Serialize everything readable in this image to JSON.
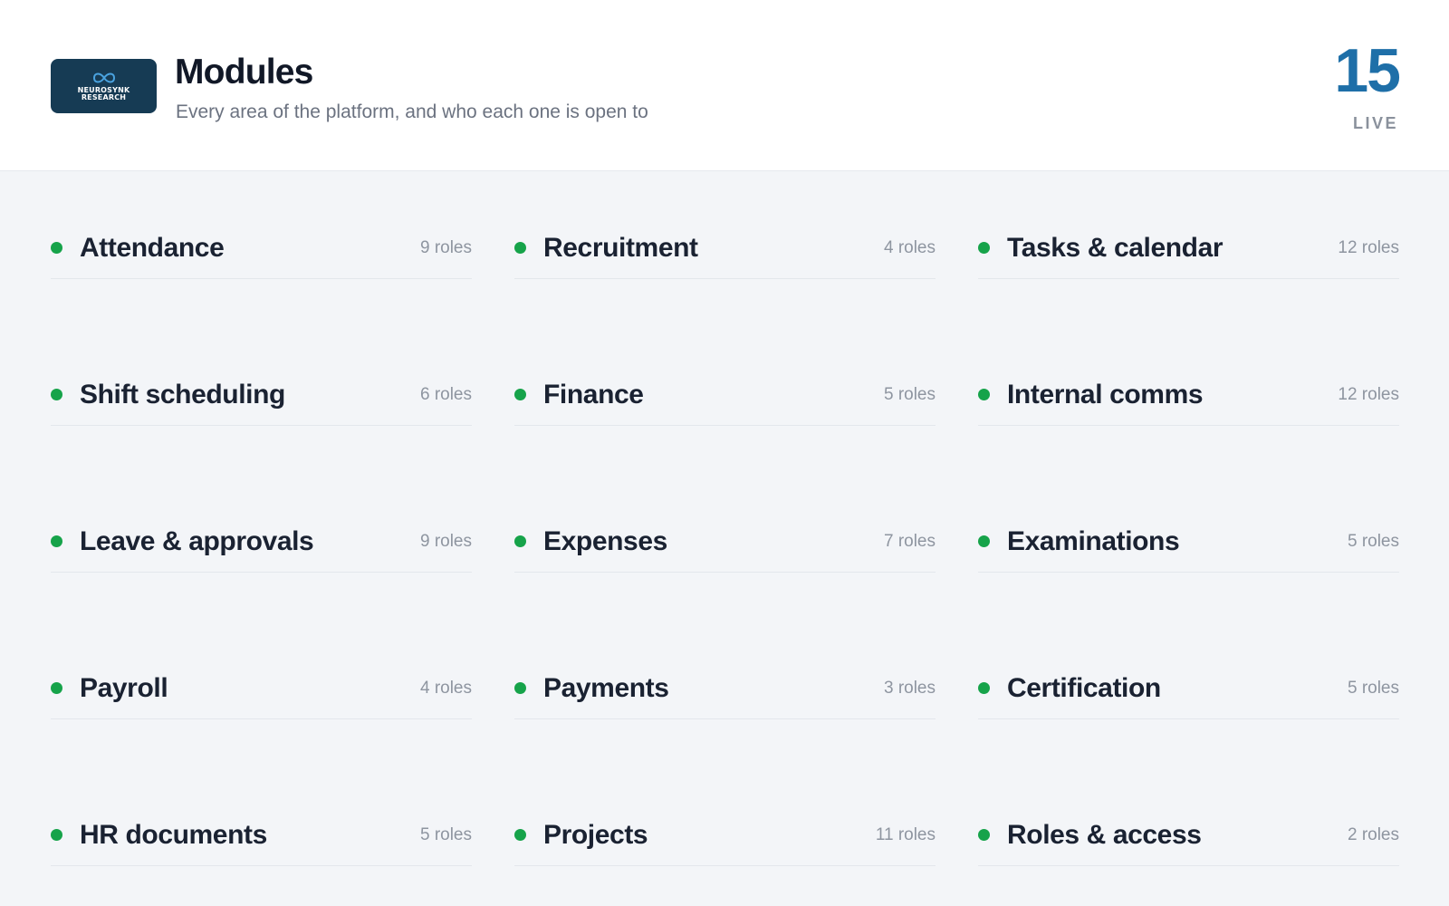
{
  "header": {
    "logo": {
      "line1": "NEUROSYNK",
      "line2": "RESEARCH",
      "icon": "infinity-icon"
    },
    "title": "Modules",
    "subtitle": "Every area of the platform, and who each one is open to",
    "count": "15",
    "count_label": "LIVE"
  },
  "colors": {
    "accent": "#1e6fa8",
    "status_dot": "#16a34a",
    "logo_bg": "#163b54"
  },
  "modules": [
    {
      "name": "Attendance",
      "roles": "9 roles"
    },
    {
      "name": "Recruitment",
      "roles": "4 roles"
    },
    {
      "name": "Tasks & calendar",
      "roles": "12 roles"
    },
    {
      "name": "Shift scheduling",
      "roles": "6 roles"
    },
    {
      "name": "Finance",
      "roles": "5 roles"
    },
    {
      "name": "Internal comms",
      "roles": "12 roles"
    },
    {
      "name": "Leave & approvals",
      "roles": "9 roles"
    },
    {
      "name": "Expenses",
      "roles": "7 roles"
    },
    {
      "name": "Examinations",
      "roles": "5 roles"
    },
    {
      "name": "Payroll",
      "roles": "4 roles"
    },
    {
      "name": "Payments",
      "roles": "3 roles"
    },
    {
      "name": "Certification",
      "roles": "5 roles"
    },
    {
      "name": "HR documents",
      "roles": "5 roles"
    },
    {
      "name": "Projects",
      "roles": "11 roles"
    },
    {
      "name": "Roles & access",
      "roles": "2 roles"
    }
  ]
}
